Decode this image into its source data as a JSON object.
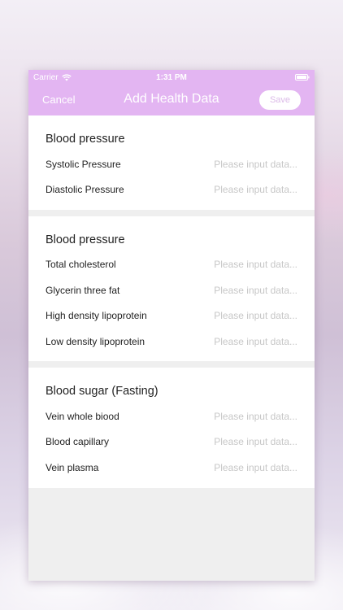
{
  "status_bar": {
    "carrier": "Carrier",
    "time": "1:31 PM",
    "wifi_icon": "wifi-icon",
    "battery_icon": "battery-icon"
  },
  "nav": {
    "cancel_label": "Cancel",
    "title": "Add Health Data",
    "save_label": "Save",
    "bar_color": "#e3b5f2"
  },
  "sections": [
    {
      "title": "Blood pressure",
      "rows": [
        {
          "label": "Systolic Pressure",
          "placeholder": "Please input data...",
          "value": ""
        },
        {
          "label": "Diastolic Pressure",
          "placeholder": "Please input data...",
          "value": ""
        }
      ]
    },
    {
      "title": "Blood pressure",
      "rows": [
        {
          "label": "Total cholesterol",
          "placeholder": "Please input data...",
          "value": ""
        },
        {
          "label": "Glycerin three fat",
          "placeholder": "Please input data...",
          "value": ""
        },
        {
          "label": "High density lipoprotein",
          "placeholder": "Please input data...",
          "value": ""
        },
        {
          "label": "Low density lipoprotein",
          "placeholder": "Please input data...",
          "value": ""
        }
      ]
    },
    {
      "title": "Blood sugar (Fasting)",
      "rows": [
        {
          "label": "Vein whole biood",
          "placeholder": "Please input data...",
          "value": ""
        },
        {
          "label": "Blood capillary",
          "placeholder": "Please input data...",
          "value": ""
        },
        {
          "label": "Vein plasma",
          "placeholder": "Please input data...",
          "value": ""
        }
      ]
    }
  ]
}
